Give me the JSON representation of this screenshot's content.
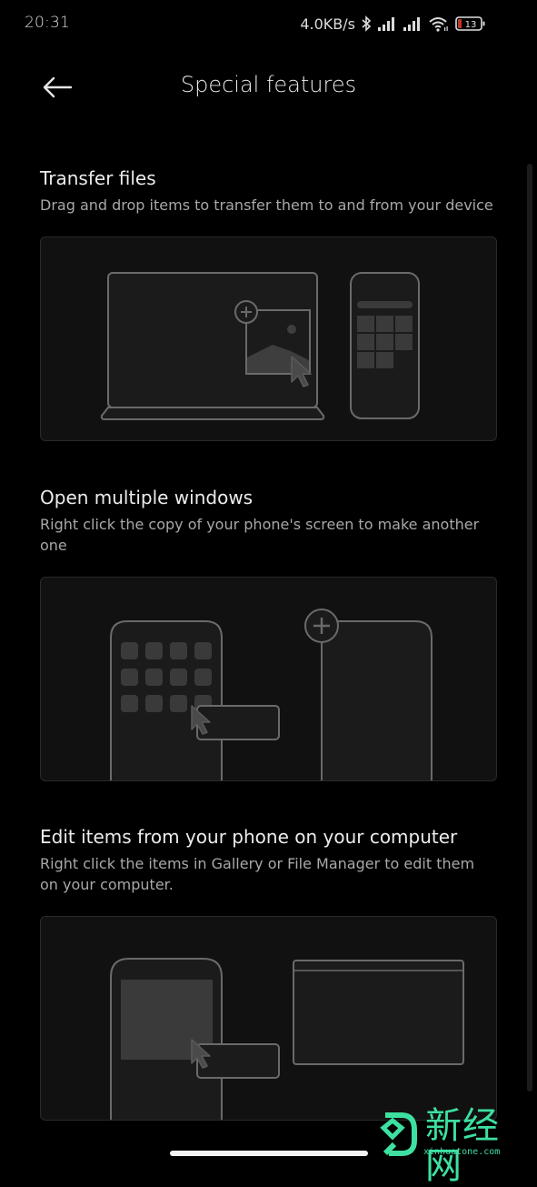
{
  "status_bar": {
    "time": "20:31",
    "net_speed": "4.0KB/s",
    "icons": [
      "bluetooth-icon",
      "signal-icon",
      "signal-icon",
      "wifi-icon",
      "battery-icon"
    ],
    "battery_level": "13",
    "battery_color": "#c0392b"
  },
  "app_bar": {
    "back_icon": "arrow-left-icon",
    "title": "Special features"
  },
  "sections": [
    {
      "title": "Transfer files",
      "description": "Drag and drop items to transfer them to and from your device",
      "illustration": "laptop-phone-drag-image"
    },
    {
      "title": "Open multiple windows",
      "description": "Right click the copy of your phone's screen to make another one",
      "illustration": "phone-copy-new-window"
    },
    {
      "title": "Edit items from your phone on your computer",
      "description": "Right click the items in Gallery or File Manager to edit them on your computer.",
      "illustration": "phone-item-to-computer-window"
    }
  ],
  "watermark": {
    "text": "新经网",
    "url": "xinhuatone.com",
    "color": "#3de0a0"
  }
}
